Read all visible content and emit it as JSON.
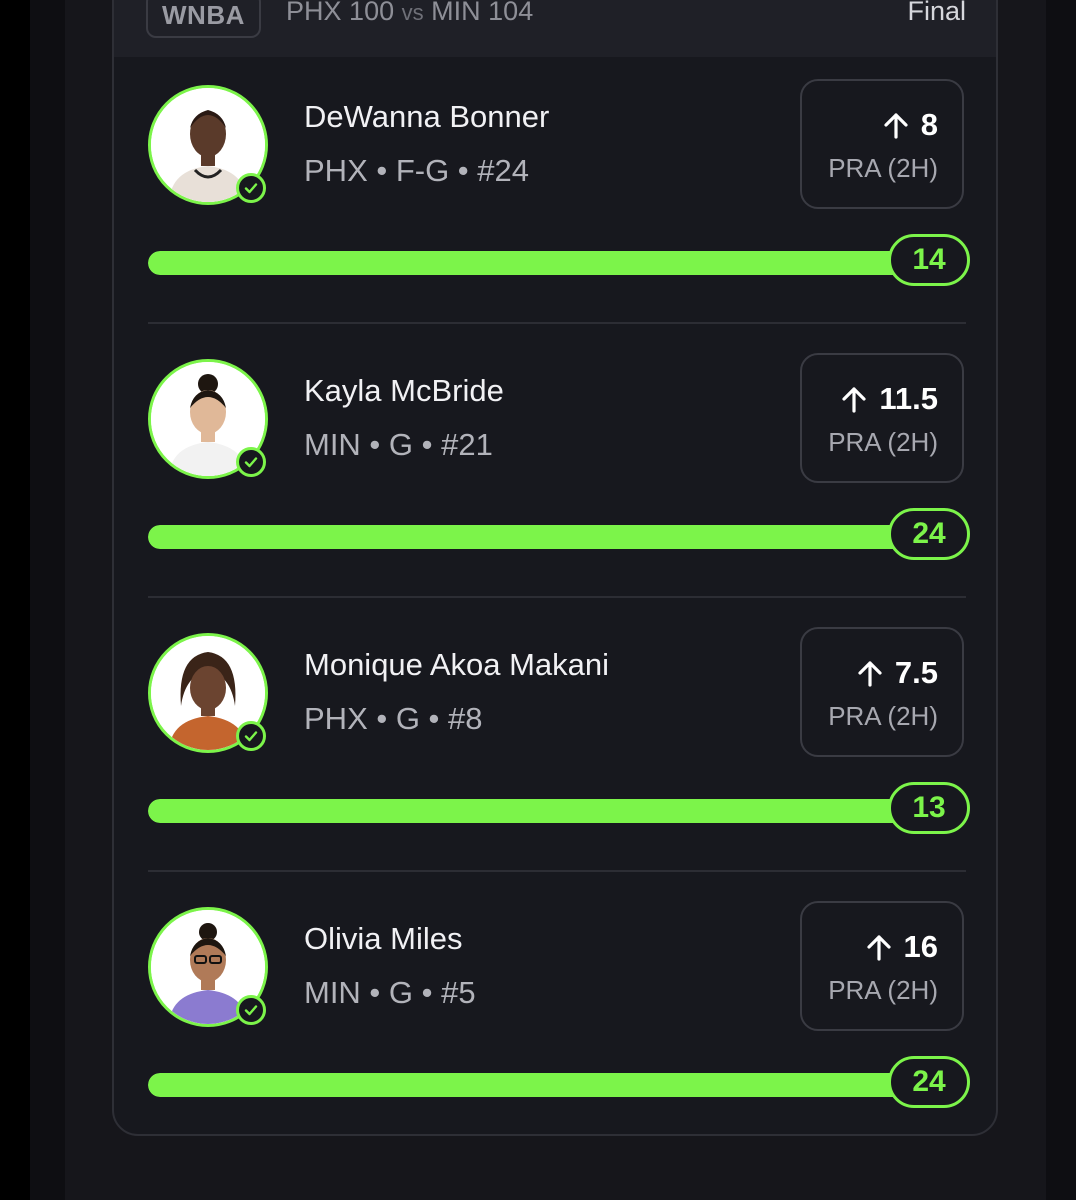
{
  "header": {
    "league": "WNBA",
    "home_team": "PHX",
    "home_score": "100",
    "vs": "vs",
    "away_team": "MIN",
    "away_score": "104",
    "status": "Final"
  },
  "colors": {
    "accent": "#7cf44a",
    "card_bg": "#17181e",
    "text_primary": "#f1f1f4",
    "text_secondary": "#b2b3ba"
  },
  "picks": [
    {
      "name": "DeWanna Bonner",
      "meta": "PHX • F-G • #24",
      "direction_icon": "arrow-up-icon",
      "line": "8",
      "stat": "PRA (2H)",
      "actual": "14",
      "progress": 1.0,
      "status_icon": "check-icon",
      "jersey_color": "#e8e0d8"
    },
    {
      "name": "Kayla McBride",
      "meta": "MIN • G • #21",
      "direction_icon": "arrow-up-icon",
      "line": "11.5",
      "stat": "PRA (2H)",
      "actual": "24",
      "progress": 1.0,
      "status_icon": "check-icon",
      "jersey_color": "#f2f2f2"
    },
    {
      "name": "Monique Akoa Makani",
      "meta": "PHX • G • #8",
      "direction_icon": "arrow-up-icon",
      "line": "7.5",
      "stat": "PRA (2H)",
      "actual": "13",
      "progress": 1.0,
      "status_icon": "check-icon",
      "jersey_color": "#c4652e"
    },
    {
      "name": "Olivia Miles",
      "meta": "MIN • G • #5",
      "direction_icon": "arrow-up-icon",
      "line": "16",
      "stat": "PRA (2H)",
      "actual": "24",
      "progress": 1.0,
      "status_icon": "check-icon",
      "jersey_color": "#8b7bd0"
    }
  ]
}
